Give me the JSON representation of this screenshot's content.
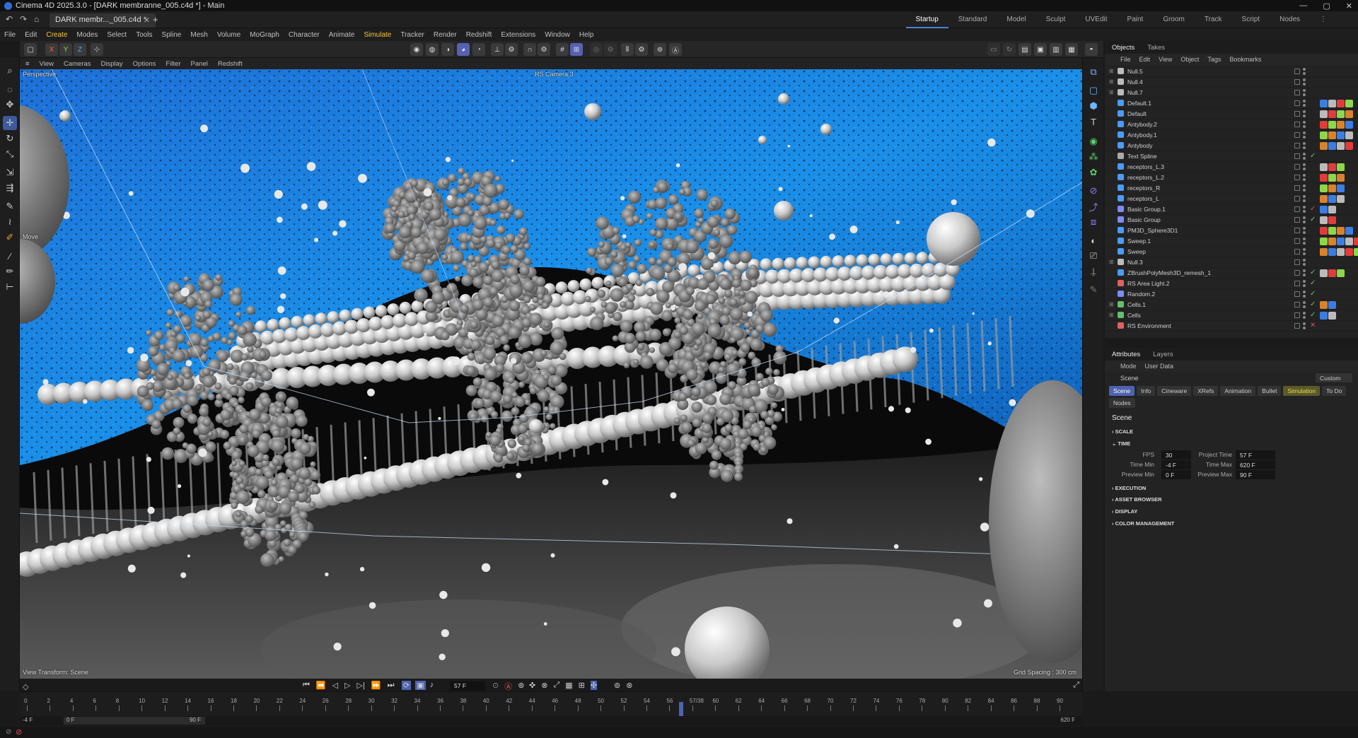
{
  "window": {
    "title": "Cinema 4D 2025.3.0 - [DARK membranne_005.c4d *] - Main",
    "controls": [
      "—",
      "▢",
      "✕"
    ]
  },
  "tabs": {
    "document": "DARK membr..._005.c4d *",
    "new": "+"
  },
  "layouts": [
    "Startup",
    "Standard",
    "Model",
    "Sculpt",
    "UVEdit",
    "Paint",
    "Groom",
    "Track",
    "Script",
    "Nodes"
  ],
  "menu": [
    "File",
    "Edit",
    "Create",
    "Modes",
    "Select",
    "Tools",
    "Spline",
    "Mesh",
    "Volume",
    "MoGraph",
    "Character",
    "Animate",
    "Simulate",
    "Tracker",
    "Render",
    "Redshift",
    "Extensions",
    "Window",
    "Help"
  ],
  "axis_labels": [
    "X",
    "Y",
    "Z"
  ],
  "viewport": {
    "menu": [
      "View",
      "Cameras",
      "Display",
      "Options",
      "Filter",
      "Panel",
      "Redshift"
    ],
    "name": "Perspective",
    "camera": "RS Camera.3",
    "mode_label": "Move",
    "transform_label": "View Transform: Scene",
    "grid_spacing": "Grid Spacing : 300 cm"
  },
  "object_manager": {
    "tabs": [
      "Objects",
      "Takes"
    ],
    "menu": [
      "File",
      "Edit",
      "View",
      "Object",
      "Tags",
      "Bookmarks"
    ],
    "objects": [
      {
        "name": "Null.5",
        "color": "#bbbbbb"
      },
      {
        "name": "Null.4",
        "color": "#bbbbbb"
      },
      {
        "name": "Null.7",
        "color": "#bbbbbb"
      },
      {
        "name": "Default.1",
        "color": "#4a9cff"
      },
      {
        "name": "Default",
        "color": "#4a9cff"
      },
      {
        "name": "Antybody.2",
        "color": "#4a9cff"
      },
      {
        "name": "Antybody.1",
        "color": "#4a9cff"
      },
      {
        "name": "Antybody",
        "color": "#4a9cff"
      },
      {
        "name": "Text Spline",
        "color": "#aaaaaa"
      },
      {
        "name": "receptors_L.3",
        "color": "#4a9cff"
      },
      {
        "name": "receptors_L.2",
        "color": "#4a9cff"
      },
      {
        "name": "receptors_R",
        "color": "#4a9cff"
      },
      {
        "name": "receptors_L",
        "color": "#4a9cff"
      },
      {
        "name": "Basic Group.1",
        "color": "#7c8cff"
      },
      {
        "name": "Basic Group",
        "color": "#7c8cff"
      },
      {
        "name": "PM3D_Sphere3D1",
        "color": "#4a9cff"
      },
      {
        "name": "Sweep.1",
        "color": "#4a9cff"
      },
      {
        "name": "Sweep",
        "color": "#4a9cff"
      },
      {
        "name": "Null.3",
        "color": "#bbbbbb"
      },
      {
        "name": "ZBrushPolyMesh3D_remesh_1",
        "color": "#4a9cff"
      },
      {
        "name": "RS Area Light.2",
        "color": "#e06060"
      },
      {
        "name": "Random.2",
        "color": "#7c8cff"
      },
      {
        "name": "Cells.1",
        "color": "#63c06a"
      },
      {
        "name": "Cells",
        "color": "#63c06a"
      },
      {
        "name": "RS Environment",
        "color": "#e06060"
      }
    ]
  },
  "attributes": {
    "tabs": [
      "Attributes",
      "Layers"
    ],
    "menu": [
      "Mode",
      "User Data"
    ],
    "object": "Scene",
    "preset": "Custom",
    "subtabs": [
      "Scene",
      "Info",
      "Cineware",
      "XRefs",
      "Animation",
      "Bullet",
      "Simulation",
      "To Do",
      "Nodes"
    ],
    "heading": "Scene",
    "sections": [
      "SCALE",
      "TIME",
      "EXECUTION",
      "ASSET BROWSER",
      "DISPLAY",
      "COLOR MANAGEMENT"
    ],
    "time": {
      "fps_label": "FPS",
      "fps": "30",
      "project_time_label": "Project Time",
      "project_time": "57 F",
      "time_min_label": "Time Min",
      "time_min": "-4 F",
      "time_max_label": "Time Max",
      "time_max": "620 F",
      "preview_min_label": "Preview Min",
      "preview_min": "0 F",
      "preview_max_label": "Preview Max",
      "preview_max": "90 F"
    }
  },
  "timeline": {
    "current_frame": "57 F",
    "ticks": [
      "0",
      "2",
      "4",
      "6",
      "8",
      "10",
      "12",
      "14",
      "16",
      "18",
      "20",
      "22",
      "24",
      "26",
      "28",
      "30",
      "32",
      "34",
      "36",
      "38",
      "40",
      "42",
      "44",
      "46",
      "48",
      "50",
      "52",
      "54",
      "56",
      "57/38",
      "60",
      "62",
      "64",
      "66",
      "68",
      "70",
      "72",
      "74",
      "76",
      "78",
      "80",
      "82",
      "84",
      "86",
      "88",
      "90"
    ],
    "start": "-4 F",
    "preview_start": "0 F",
    "preview_end": "90 F",
    "end": "620 F"
  }
}
